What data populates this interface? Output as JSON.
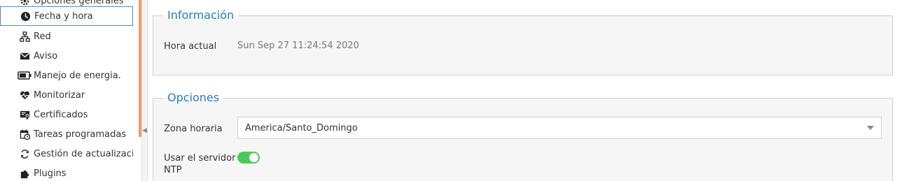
{
  "sidebar": {
    "items": [
      {
        "label": "Opciones generales",
        "icon": "gear-icon"
      },
      {
        "label": "Fecha y hora",
        "icon": "clock-icon",
        "selected": true
      },
      {
        "label": "Red",
        "icon": "network-icon"
      },
      {
        "label": "Aviso",
        "icon": "envelope-icon"
      },
      {
        "label": "Manejo de energia.",
        "icon": "battery-icon"
      },
      {
        "label": "Monitorizar",
        "icon": "heartbeat-icon"
      },
      {
        "label": "Certificados",
        "icon": "certificate-icon"
      },
      {
        "label": "Tareas programadas",
        "icon": "calendar-clock-icon"
      },
      {
        "label": "Gestión de actualizaciones",
        "icon": "refresh-icon"
      },
      {
        "label": "Plugins",
        "icon": "puzzle-icon"
      }
    ]
  },
  "info": {
    "legend": "Información",
    "current_time_label": "Hora actual",
    "current_time_value": "Sun Sep 27 11:24:54 2020"
  },
  "options": {
    "legend": "Opciones",
    "timezone_label": "Zona horaria",
    "timezone_value": "America/Santo_Domingo",
    "ntp_label_line1": "Usar el servidor",
    "ntp_label_line2": "NTP",
    "ntp_enabled": true
  },
  "colors": {
    "accent": "#2a7fc0",
    "toggle_on": "#4cc95a",
    "splitter_accent": "#f09a70"
  }
}
